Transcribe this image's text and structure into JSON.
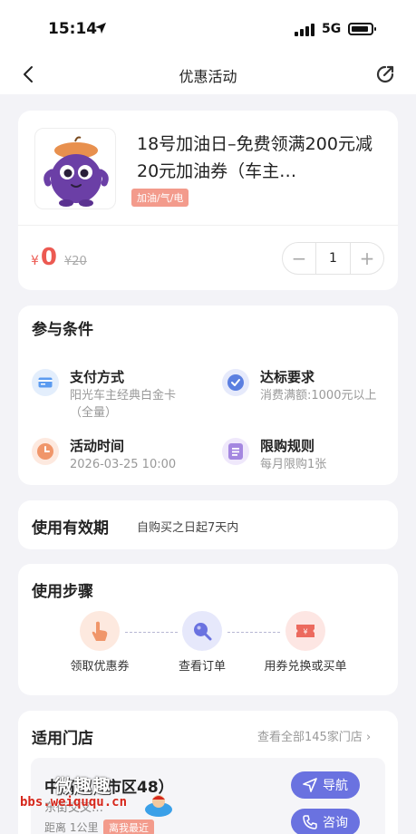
{
  "status_bar": {
    "time": "15:14",
    "network": "5G",
    "icons": [
      "location-arrow-icon",
      "signal-icon",
      "battery-icon"
    ]
  },
  "nav": {
    "title": "优惠活动",
    "back_icon": "chevron-left-icon",
    "share_icon": "share-icon"
  },
  "product": {
    "title": "18号加油日–免费领满200元减20元加油券（车主…",
    "tag": "加油/气/电",
    "price_currency": "¥",
    "price": "0",
    "original_price": "¥20",
    "quantity": "1",
    "minus": "−",
    "plus": "+"
  },
  "conditions": {
    "title": "参与条件",
    "items": [
      {
        "label": "支付方式",
        "value": "阳光车主经典白金卡（全量）",
        "icon": "card-icon",
        "color": "#5b9bf0"
      },
      {
        "label": "达标要求",
        "value": "消费满额:1000元以上",
        "icon": "check-circle-icon",
        "color": "#5b7fe0"
      },
      {
        "label": "活动时间",
        "value": "2026-03-25 10:00",
        "icon": "clock-icon",
        "color": "#f0966a"
      },
      {
        "label": "限购规则",
        "value": "每月限购1张",
        "icon": "list-icon",
        "color": "#a487e0"
      }
    ]
  },
  "validity": {
    "label": "使用有效期",
    "value": "自购买之日起7天内"
  },
  "steps": {
    "title": "使用步骤",
    "items": [
      {
        "label": "领取优惠券",
        "icon": "tap-hand-icon"
      },
      {
        "label": "查看订单",
        "icon": "magnifier-icon"
      },
      {
        "label": "用券兑换或买单",
        "icon": "ticket-icon"
      }
    ]
  },
  "stores": {
    "title": "适用门店",
    "view_all": "查看全部145家门店",
    "store": {
      "name": "中石化（市区48）",
      "address": "东街交叉…",
      "distance": "距离 1公里",
      "badge": "离我最近",
      "navigate_label": "导航",
      "consult_label": "咨询"
    }
  },
  "watermark": {
    "title": "微趣趣",
    "url": "bbs.weiququ.cn"
  }
}
